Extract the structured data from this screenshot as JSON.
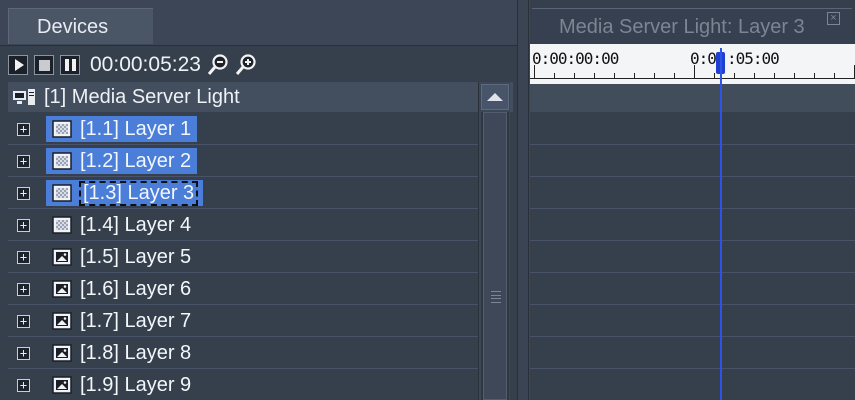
{
  "left": {
    "tab_label": "Devices",
    "timecode": "00:00:05:23",
    "server": {
      "label": "[1] Media Server Light",
      "icon": "computer-icon"
    },
    "layers": [
      {
        "label": "[1.1] Layer 1",
        "icon": "layer-texture-icon",
        "selected": true,
        "focused": false
      },
      {
        "label": "[1.2] Layer 2",
        "icon": "layer-texture-icon",
        "selected": true,
        "focused": false
      },
      {
        "label": "[1.3] Layer 3",
        "icon": "layer-texture-icon",
        "selected": true,
        "focused": true
      },
      {
        "label": "[1.4] Layer 4",
        "icon": "layer-texture-icon",
        "selected": false,
        "focused": false
      },
      {
        "label": "[1.5] Layer 5",
        "icon": "layer-image-icon",
        "selected": false,
        "focused": false
      },
      {
        "label": "[1.6] Layer 6",
        "icon": "layer-image-icon",
        "selected": false,
        "focused": false
      },
      {
        "label": "[1.7] Layer 7",
        "icon": "layer-image-icon",
        "selected": false,
        "focused": false
      },
      {
        "label": "[1.8] Layer 8",
        "icon": "layer-image-icon",
        "selected": false,
        "focused": false
      },
      {
        "label": "[1.9] Layer 9",
        "icon": "layer-image-icon",
        "selected": false,
        "focused": false
      }
    ]
  },
  "right": {
    "tab_label": "Media Server Light: Layer 3",
    "ruler": {
      "start_label": "0:00:00:00",
      "mid_label": "0:0",
      "mid_label_after": ":05:00"
    }
  },
  "colors": {
    "selection": "#4a7ed8",
    "playhead": "#2a55e8",
    "panel_bg": "#36404d"
  }
}
